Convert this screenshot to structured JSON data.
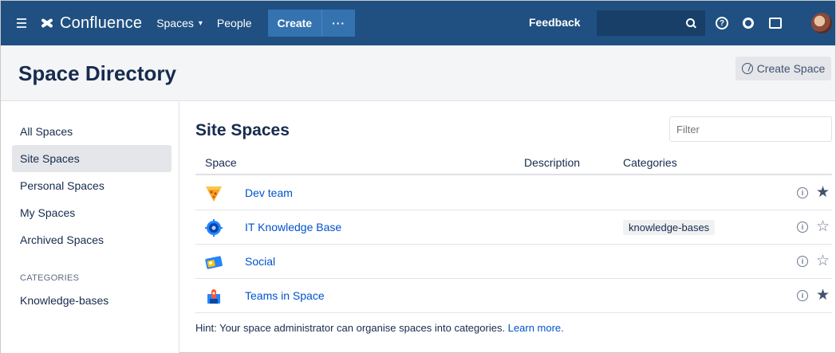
{
  "app": {
    "name": "Confluence"
  },
  "nav": {
    "spaces_label": "Spaces",
    "people_label": "People",
    "create_label": "Create",
    "more_label": "···",
    "feedback_label": "Feedback",
    "help_icon": "?"
  },
  "header": {
    "title": "Space Directory",
    "create_space_label": "Create Space"
  },
  "sidebar": {
    "items": [
      {
        "label": "All Spaces",
        "active": false
      },
      {
        "label": "Site Spaces",
        "active": true
      },
      {
        "label": "Personal Spaces",
        "active": false
      },
      {
        "label": "My Spaces",
        "active": false
      },
      {
        "label": "Archived Spaces",
        "active": false
      }
    ],
    "categories_heading": "CATEGORIES",
    "categories": [
      {
        "label": "Knowledge-bases"
      }
    ]
  },
  "main": {
    "title": "Site Spaces",
    "filter_placeholder": "Filter",
    "columns": {
      "space": "Space",
      "description": "Description",
      "categories": "Categories"
    },
    "rows": [
      {
        "name": "Dev team",
        "category": "",
        "favorite": true,
        "icon": "pizza-slice-icon"
      },
      {
        "name": "IT Knowledge Base",
        "category": "knowledge-bases",
        "favorite": false,
        "icon": "gear-badge-icon"
      },
      {
        "name": "Social",
        "category": "",
        "favorite": false,
        "icon": "social-card-icon"
      },
      {
        "name": "Teams in Space",
        "category": "",
        "favorite": true,
        "icon": "rocket-icon"
      }
    ],
    "info_icon": "i",
    "hint_text": "Hint: Your space administrator can organise spaces into categories. ",
    "hint_link": "Learn more."
  },
  "icons": {
    "star_filled": "★",
    "star_empty": "☆"
  },
  "colors": {
    "nav_bg": "#205081",
    "link": "#0052cc",
    "create_btn": "#3572b0"
  }
}
